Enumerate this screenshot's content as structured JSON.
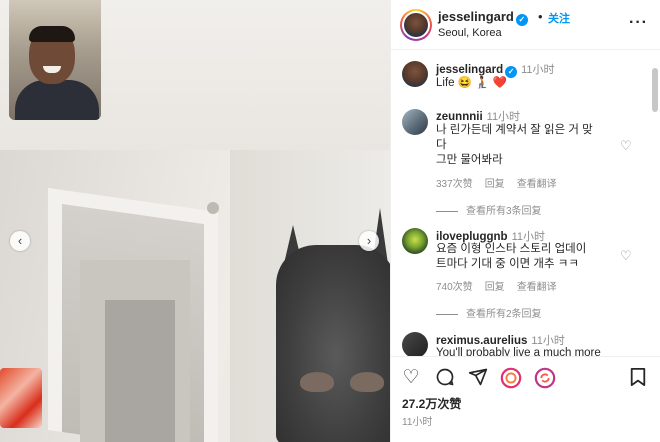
{
  "post": {
    "username": "jesselingard",
    "separator": "•",
    "follow_label": "关注",
    "location": "Seoul, Korea",
    "more_icon": "more-horizontal-icon"
  },
  "caption": {
    "username": "jesselingard",
    "time": "11小时",
    "text": "Life 😆 🧎🏾 ❤️"
  },
  "comments": [
    {
      "username": "zeunnnii",
      "time": "11小时",
      "line1": "나 린가든데 계약서 잘 읽은 거 맞",
      "line2": "다",
      "line3": "그만 물어봐라",
      "likes": "337次赞",
      "reply": "回复",
      "translate": "查看翻译",
      "view_replies": "查看所有3条回复"
    },
    {
      "username": "ilovepluggnb",
      "time": "11小时",
      "line1": "요즘 이형 인스타 스토리 업데이",
      "line2": "트마다 기대 중 이면 개추 ㅋㅋ",
      "likes": "740次赞",
      "reply": "回复",
      "translate": "查看翻译",
      "view_replies": "查看所有2条回复"
    },
    {
      "username": "reximus.aurelius",
      "time": "11小时",
      "line1": "You'll probably live a much more"
    }
  ],
  "footer": {
    "likes": "27.2万次赞",
    "time": "11小时"
  },
  "colors": {
    "link": "#0095f6",
    "meta": "#8e8e8e",
    "text": "#262626"
  }
}
